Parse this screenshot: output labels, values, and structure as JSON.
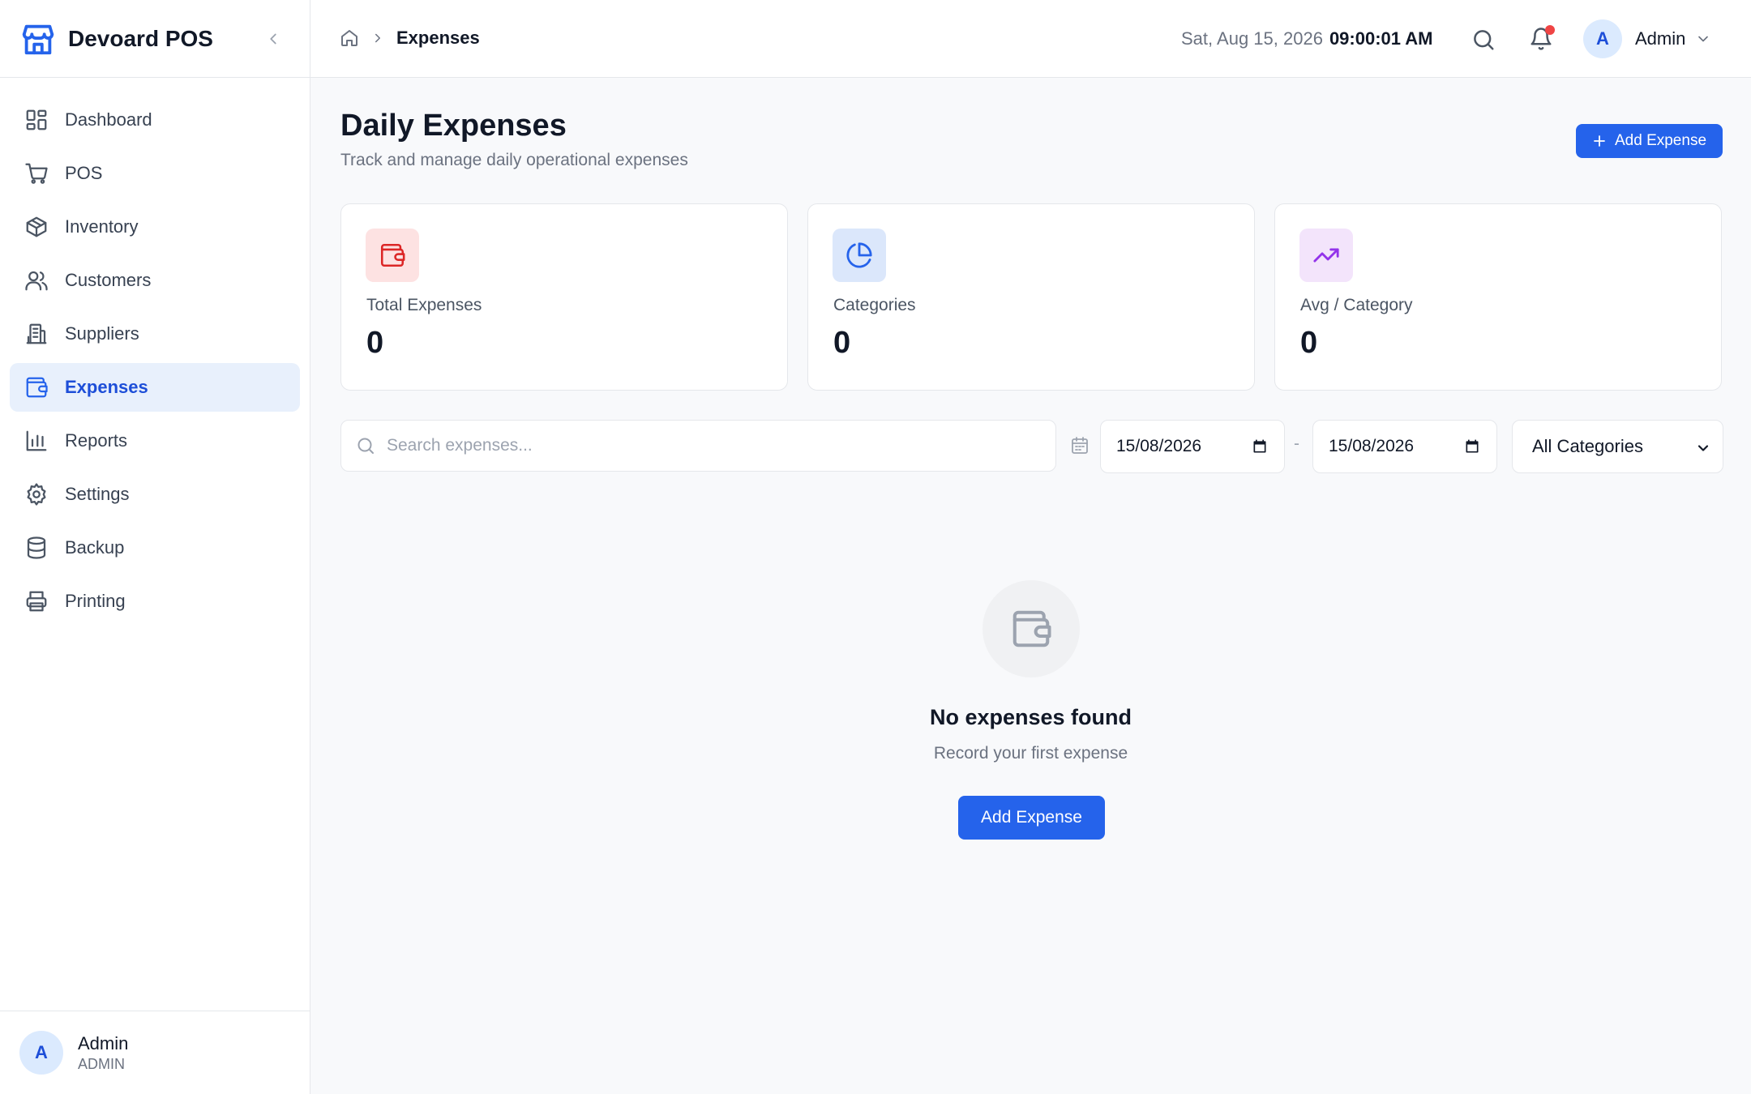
{
  "app": {
    "name": "Devoard POS"
  },
  "sidebar": {
    "items": [
      {
        "label": "Dashboard",
        "icon": "dashboard-icon"
      },
      {
        "label": "POS",
        "icon": "cart-icon"
      },
      {
        "label": "Inventory",
        "icon": "box-icon"
      },
      {
        "label": "Customers",
        "icon": "users-icon"
      },
      {
        "label": "Suppliers",
        "icon": "building-icon"
      },
      {
        "label": "Expenses",
        "icon": "wallet-icon",
        "active": true
      },
      {
        "label": "Reports",
        "icon": "bar-chart-icon"
      },
      {
        "label": "Settings",
        "icon": "gear-icon"
      },
      {
        "label": "Backup",
        "icon": "database-icon"
      },
      {
        "label": "Printing",
        "icon": "printer-icon"
      }
    ],
    "user": {
      "initial": "A",
      "name": "Admin",
      "role": "ADMIN"
    }
  },
  "header": {
    "breadcrumb_current": "Expenses",
    "date": "Sat, Aug 15, 2026",
    "time": "09:00:01 AM",
    "user": {
      "initial": "A",
      "name": "Admin"
    }
  },
  "page": {
    "title": "Daily Expenses",
    "subtitle": "Track and manage daily operational expenses",
    "add_button": "Add Expense"
  },
  "stats": [
    {
      "label": "Total Expenses",
      "value": "0",
      "icon": "wallet-icon",
      "color": "#dc2626",
      "bg": "#fde2e2"
    },
    {
      "label": "Categories",
      "value": "0",
      "icon": "pie-chart-icon",
      "color": "#2563eb",
      "bg": "#dbe7fb"
    },
    {
      "label": "Avg / Category",
      "value": "0",
      "icon": "trending-up-icon",
      "color": "#9333ea",
      "bg": "#f3e4fb"
    }
  ],
  "filters": {
    "search_placeholder": "Search expenses...",
    "date_from": "15/08/2026",
    "date_separator": "-",
    "date_to": "15/08/2026",
    "category_selected": "All Categories"
  },
  "empty": {
    "title": "No expenses found",
    "subtitle": "Record your first expense",
    "button": "Add Expense"
  },
  "colors": {
    "primary": "#2563eb",
    "active_bg": "#e8f0fc",
    "notification": "#ef4444"
  }
}
